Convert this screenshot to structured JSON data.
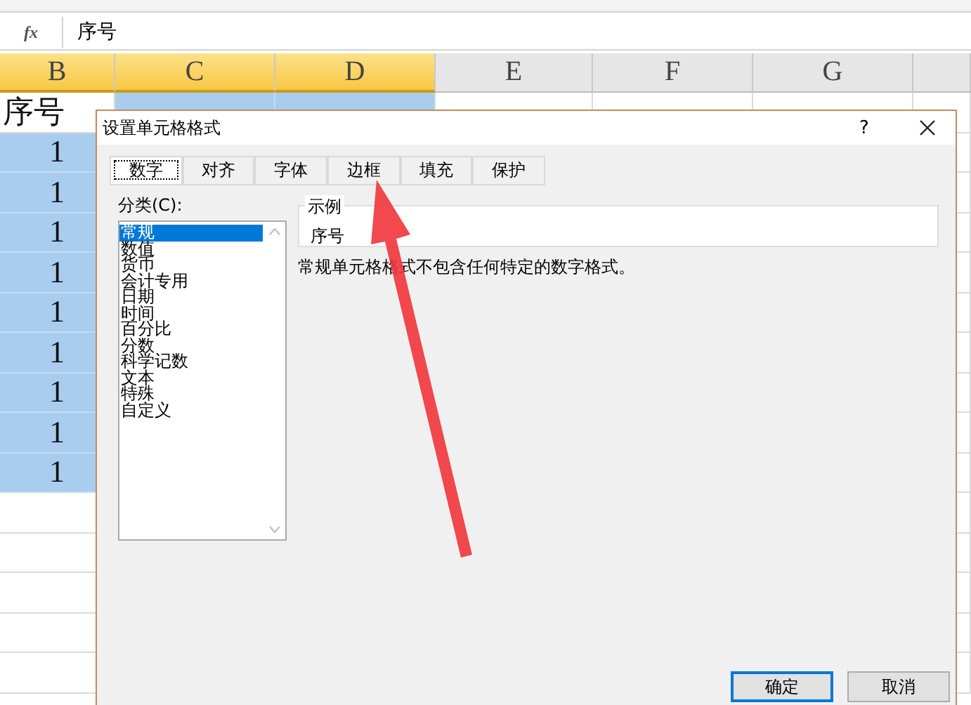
{
  "formula_bar": {
    "fx_label": "fx",
    "value": "序号"
  },
  "sheet": {
    "columns": [
      {
        "label": "B",
        "selected": true
      },
      {
        "label": "C",
        "selected": true
      },
      {
        "label": "D",
        "selected": true
      },
      {
        "label": "E",
        "selected": false
      },
      {
        "label": "F",
        "selected": false
      },
      {
        "label": "G",
        "selected": false
      }
    ],
    "rows": [
      [
        {
          "text": "序号",
          "selected": false
        },
        {
          "selected": true
        },
        {
          "selected": true
        }
      ],
      [
        {
          "text": "1",
          "selected": true
        }
      ],
      [
        {
          "text": "1",
          "selected": true
        }
      ],
      [
        {
          "text": "1",
          "selected": true
        }
      ],
      [
        {
          "text": "1",
          "selected": true
        }
      ],
      [
        {
          "text": "1",
          "selected": true
        }
      ],
      [
        {
          "text": "1",
          "selected": true
        }
      ],
      [
        {
          "text": "1",
          "selected": true
        }
      ],
      [
        {
          "text": "1",
          "selected": true
        }
      ],
      [
        {
          "text": "1",
          "selected": true
        }
      ]
    ]
  },
  "dialog": {
    "title": "设置单元格格式",
    "help": "?",
    "tabs": [
      {
        "label": "数字",
        "selected": true
      },
      {
        "label": "对齐",
        "selected": false
      },
      {
        "label": "字体",
        "selected": false
      },
      {
        "label": "边框",
        "selected": false
      },
      {
        "label": "填充",
        "selected": false
      },
      {
        "label": "保护",
        "selected": false
      }
    ],
    "category_label": "分类(C):",
    "categories": [
      {
        "label": "常规",
        "selected": true
      },
      {
        "label": "数值",
        "selected": false
      },
      {
        "label": "货币",
        "selected": false
      },
      {
        "label": "会计专用",
        "selected": false
      },
      {
        "label": "日期",
        "selected": false
      },
      {
        "label": "时间",
        "selected": false
      },
      {
        "label": "百分比",
        "selected": false
      },
      {
        "label": "分数",
        "selected": false
      },
      {
        "label": "科学记数",
        "selected": false
      },
      {
        "label": "文本",
        "selected": false
      },
      {
        "label": "特殊",
        "selected": false
      },
      {
        "label": "自定义",
        "selected": false
      }
    ],
    "sample_label": "示例",
    "sample_value": "序号",
    "description": "常规单元格格式不包含任何特定的数字格式。",
    "buttons": [
      {
        "label": "确定",
        "kind": "default"
      },
      {
        "label": "取消",
        "kind": "normal"
      }
    ]
  }
}
